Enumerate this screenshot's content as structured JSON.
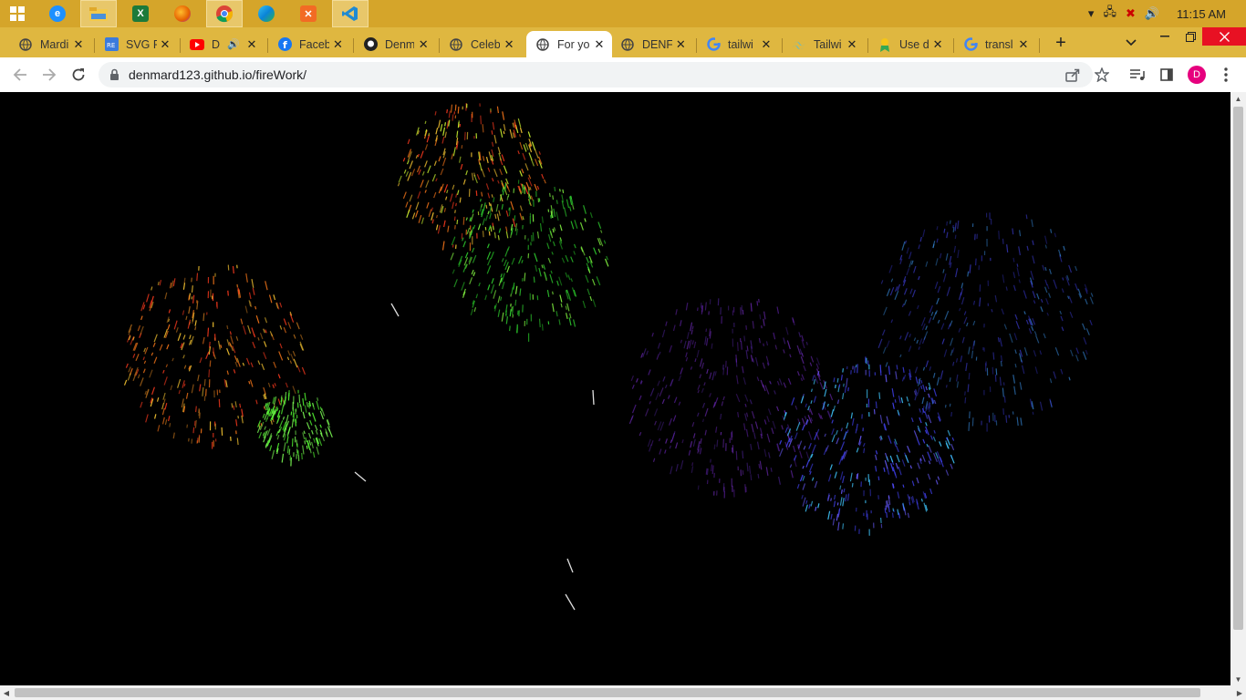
{
  "taskbar": {
    "apps": [
      {
        "name": "windows-start",
        "icon": "windows-logo-icon"
      },
      {
        "name": "internet-explorer",
        "icon": "ie-icon",
        "color": "#1e90ff"
      },
      {
        "name": "file-explorer",
        "icon": "folder-icon",
        "color": "#f2c94c"
      },
      {
        "name": "excel",
        "icon": "excel-icon",
        "color": "#1d7a3a"
      },
      {
        "name": "firefox",
        "icon": "firefox-icon",
        "color": "#e66000"
      },
      {
        "name": "chrome",
        "icon": "chrome-icon",
        "color": "#4285f4"
      },
      {
        "name": "edge",
        "icon": "edge-icon",
        "color": "#0a84d8"
      },
      {
        "name": "xampp",
        "icon": "xampp-icon",
        "color": "#f26b24"
      },
      {
        "name": "vscode",
        "icon": "vscode-icon",
        "color": "#1f8ad2"
      }
    ],
    "clock": "11:15 AM"
  },
  "tabs": [
    {
      "title": "Mardi",
      "favicon": "globe-icon"
    },
    {
      "title": "SVG R",
      "favicon": "svgrepo-icon"
    },
    {
      "title": "D",
      "favicon": "youtube-icon",
      "audio": true
    },
    {
      "title": "Faceb",
      "favicon": "facebook-icon"
    },
    {
      "title": "Denm",
      "favicon": "github-icon"
    },
    {
      "title": "Celeb",
      "favicon": "globe-icon"
    },
    {
      "title": "For yo",
      "favicon": "globe-icon",
      "active": true
    },
    {
      "title": "DENF",
      "favicon": "globe-icon"
    },
    {
      "title": "tailwi",
      "favicon": "google-icon"
    },
    {
      "title": "Tailwi",
      "favicon": "tailwind-icon"
    },
    {
      "title": "Use d",
      "favicon": "user-badge-icon"
    },
    {
      "title": "transl",
      "favicon": "google-icon"
    }
  ],
  "address_bar": {
    "url": "denmard123.github.io/fireWork/"
  },
  "profile": {
    "initial": "D",
    "color": "#e6007e"
  },
  "colors": {
    "taskbar": "#d5a52a",
    "tabstrip": "#dfb740",
    "background": "#000000",
    "fireworks": [
      "#ff3b1f",
      "#ffcc33",
      "#33dd33",
      "#55ff33",
      "#9a3cff",
      "#4646ff",
      "#40c8ff"
    ]
  }
}
